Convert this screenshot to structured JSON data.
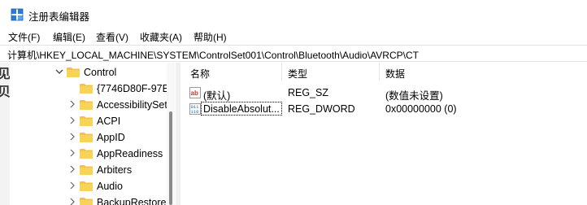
{
  "window": {
    "title": "注册表编辑器"
  },
  "menu": [
    "文件(F)",
    "编辑(E)",
    "查看(V)",
    "收藏夹(A)",
    "帮助(H)"
  ],
  "address": "计算机\\HKEY_LOCAL_MACHINE\\SYSTEM\\ControlSet001\\Control\\Bluetooth\\Audio\\AVRCP\\CT",
  "left_strip": [
    "见",
    "贝"
  ],
  "tree": [
    {
      "label": "Control",
      "expanded": true
    },
    {
      "label": "{7746D80F-97E",
      "expanded": false,
      "has_children": false
    },
    {
      "label": "AccessibilitySet",
      "has_children": true
    },
    {
      "label": "ACPI",
      "has_children": true
    },
    {
      "label": "AppID",
      "has_children": true
    },
    {
      "label": "AppReadiness",
      "has_children": true
    },
    {
      "label": "Arbiters",
      "has_children": true
    },
    {
      "label": "Audio",
      "has_children": true
    },
    {
      "label": "BackupRestore",
      "has_children": true
    }
  ],
  "list": {
    "columns": [
      "名称",
      "类型",
      "数据"
    ],
    "rows": [
      {
        "icon": "string-value-icon",
        "name": "(默认)",
        "type": "REG_SZ",
        "data": "(数值未设置)"
      },
      {
        "icon": "dword-value-icon",
        "name": "DisableAbsolut...",
        "type": "REG_DWORD",
        "data": "0x00000000 (0)"
      }
    ]
  },
  "colors": {
    "folder": "#f3c444",
    "accent": "#0067c0"
  }
}
